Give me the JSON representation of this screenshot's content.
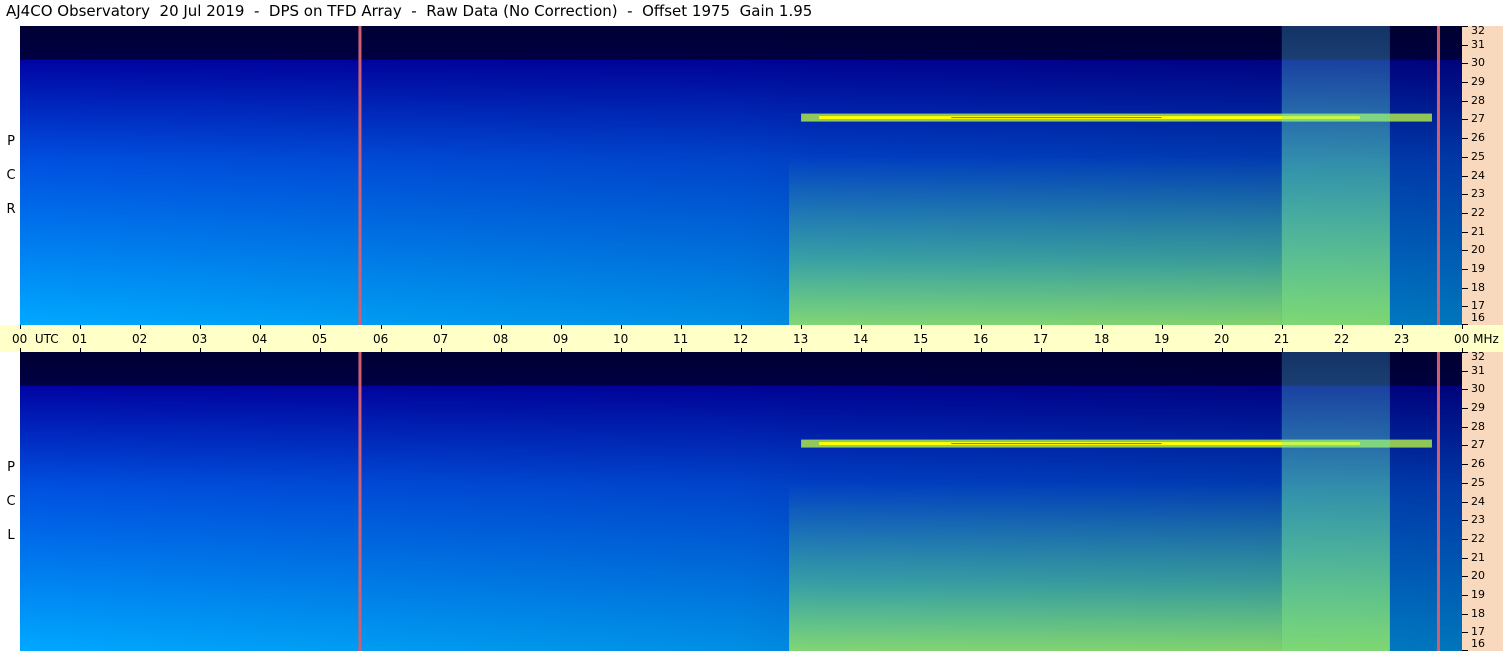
{
  "header": {
    "title": "AJ4CO Observatory  20 Jul 2019  -  DPS on TFD Array  -  Raw Data (No Correction)  -  Offset 1975  Gain 1.95"
  },
  "chart_data": {
    "type": "heatmap",
    "title": "AJ4CO Observatory  20 Jul 2019  -  DPS on TFD Array  -  Raw Data (No Correction)  -  Offset 1975  Gain 1.95",
    "panels": [
      {
        "polarization": "RCP",
        "letters": [
          "R",
          "C",
          "P"
        ]
      },
      {
        "polarization": "LCP",
        "letters": [
          "L",
          "C",
          "P"
        ]
      }
    ],
    "x_axis": {
      "label": "UTC",
      "range_hours": [
        0,
        24
      ],
      "ticks": [
        "00",
        "01",
        "02",
        "03",
        "04",
        "05",
        "06",
        "07",
        "08",
        "09",
        "10",
        "11",
        "12",
        "13",
        "14",
        "15",
        "16",
        "17",
        "18",
        "19",
        "20",
        "21",
        "22",
        "23",
        "00"
      ],
      "first_label_suffix": "UTC"
    },
    "y_axis": {
      "unit": "MHz",
      "range_mhz": [
        16,
        32
      ],
      "ticks": [
        "32",
        "31",
        "30",
        "29",
        "28",
        "27",
        "26",
        "25",
        "24",
        "23",
        "22",
        "21",
        "20",
        "19",
        "18",
        "17",
        "16"
      ]
    },
    "markers_hours": [
      5.65,
      23.6
    ],
    "colormap": [
      "#000033",
      "#0000a0",
      "#0050e0",
      "#00a8ff",
      "#40e0c0",
      "#c0ff40",
      "#ffff00",
      "#ff0000"
    ],
    "features": [
      {
        "kind": "daytime-brightening",
        "start_hour": 12.8,
        "end_hour": 21.0
      },
      {
        "kind": "strong-band",
        "freq_mhz": 27.1,
        "start_hour": 13.0,
        "end_hour": 23.5
      },
      {
        "kind": "broadband-burst",
        "start_hour": 21.0,
        "end_hour": 22.8
      }
    ]
  },
  "colors": {
    "time_axis_bg": "#ffffc8",
    "freq_axis_bg": "#f9d9bd",
    "marker_line": "#d06070"
  }
}
